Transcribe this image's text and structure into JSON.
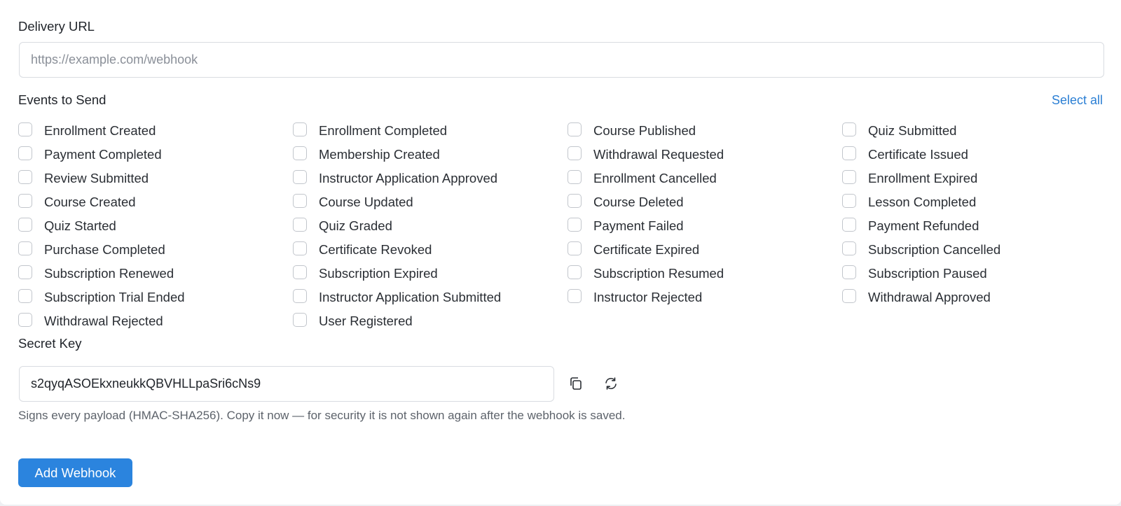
{
  "delivery_url": {
    "label": "Delivery URL",
    "value": "",
    "placeholder": "https://example.com/webhook"
  },
  "events": {
    "label": "Events to Send",
    "select_all_label": "Select all",
    "items": [
      {
        "label": "Enrollment Created",
        "checked": false
      },
      {
        "label": "Enrollment Completed",
        "checked": false
      },
      {
        "label": "Course Published",
        "checked": false
      },
      {
        "label": "Quiz Submitted",
        "checked": false
      },
      {
        "label": "Payment Completed",
        "checked": false
      },
      {
        "label": "Membership Created",
        "checked": false
      },
      {
        "label": "Withdrawal Requested",
        "checked": false
      },
      {
        "label": "Certificate Issued",
        "checked": false
      },
      {
        "label": "Review Submitted",
        "checked": false
      },
      {
        "label": "Instructor Application Approved",
        "checked": false
      },
      {
        "label": "Enrollment Cancelled",
        "checked": false
      },
      {
        "label": "Enrollment Expired",
        "checked": false
      },
      {
        "label": "Course Created",
        "checked": false
      },
      {
        "label": "Course Updated",
        "checked": false
      },
      {
        "label": "Course Deleted",
        "checked": false
      },
      {
        "label": "Lesson Completed",
        "checked": false
      },
      {
        "label": "Quiz Started",
        "checked": false
      },
      {
        "label": "Quiz Graded",
        "checked": false
      },
      {
        "label": "Payment Failed",
        "checked": false
      },
      {
        "label": "Payment Refunded",
        "checked": false
      },
      {
        "label": "Purchase Completed",
        "checked": false
      },
      {
        "label": "Certificate Revoked",
        "checked": false
      },
      {
        "label": "Certificate Expired",
        "checked": false
      },
      {
        "label": "Subscription Cancelled",
        "checked": false
      },
      {
        "label": "Subscription Renewed",
        "checked": false
      },
      {
        "label": "Subscription Expired",
        "checked": false
      },
      {
        "label": "Subscription Resumed",
        "checked": false
      },
      {
        "label": "Subscription Paused",
        "checked": false
      },
      {
        "label": "Subscription Trial Ended",
        "checked": false
      },
      {
        "label": "Instructor Application Submitted",
        "checked": false
      },
      {
        "label": "Instructor Rejected",
        "checked": false
      },
      {
        "label": "Withdrawal Approved",
        "checked": false
      },
      {
        "label": "Withdrawal Rejected",
        "checked": false
      },
      {
        "label": "User Registered",
        "checked": false
      }
    ]
  },
  "secret_key": {
    "label": "Secret Key",
    "value": "s2qyqASOEkxneukkQBVHLLpaSri6cNs9",
    "copy_icon": "copy-icon",
    "regenerate_icon": "refresh-icon",
    "help_text": "Signs every payload (HMAC-SHA256). Copy it now — for security it is not shown again after the webhook is saved."
  },
  "submit": {
    "label": "Add Webhook"
  },
  "colors": {
    "accent": "#2b84de",
    "link": "#2b7fd4",
    "border": "#d9dce1"
  }
}
